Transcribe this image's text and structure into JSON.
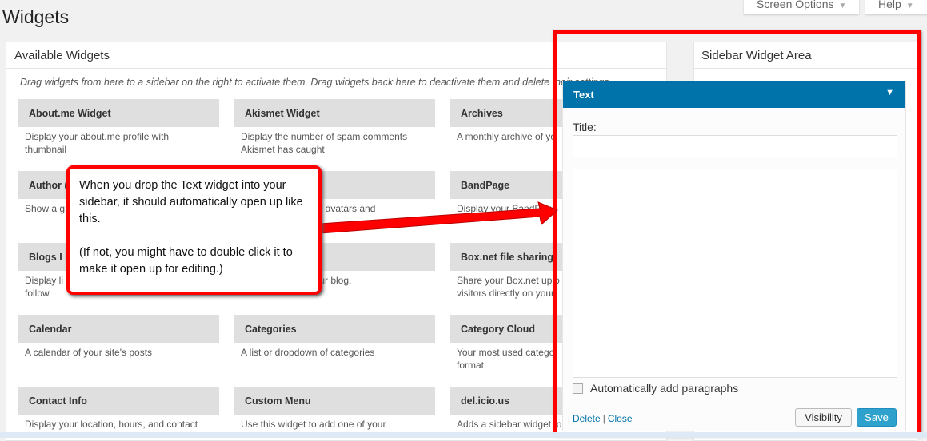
{
  "page": {
    "title": "Widgets",
    "screen_options": "Screen Options",
    "help": "Help"
  },
  "available": {
    "heading": "Available Widgets",
    "hint": "Drag widgets from here to a sidebar on the right to activate them. Drag widgets back here to deactivate them and delete their settings.",
    "widgets": [
      {
        "title": "About.me Widget",
        "desc": [
          "Display your about.me profile with",
          "thumbnail"
        ]
      },
      {
        "title": "Akismet Widget",
        "desc": [
          "Display the number of spam comments",
          "Akismet has caught"
        ]
      },
      {
        "title": "Archives",
        "desc": [
          "A monthly archive of yo"
        ]
      },
      {
        "title": "Author (",
        "desc": [
          "Show a g"
        ]
      },
      {
        "title": "",
        "desc": [
          "ors with avatars and"
        ]
      },
      {
        "title": "BandPage",
        "desc": [
          "Display your BandPage"
        ]
      },
      {
        "title": "Blogs I F",
        "desc": [
          "Display li",
          "follow"
        ]
      },
      {
        "title": "",
        "desc": [
          "r for your blog."
        ]
      },
      {
        "title": "Box.net file sharing",
        "desc": [
          "Share your Box.net uplo",
          "visitors directly on your"
        ]
      },
      {
        "title": "Calendar",
        "desc": [
          "A calendar of your site's posts"
        ]
      },
      {
        "title": "Categories",
        "desc": [
          "A list or dropdown of categories"
        ]
      },
      {
        "title": "Category Cloud",
        "desc": [
          "Your most used categor",
          "format."
        ]
      },
      {
        "title": "Contact Info",
        "desc": [
          "Display your location, hours, and contact"
        ]
      },
      {
        "title": "Custom Menu",
        "desc": [
          "Use this widget to add one of your"
        ]
      },
      {
        "title": "del.icio.us",
        "desc": [
          "Adds a sidebar widget to"
        ]
      }
    ]
  },
  "sidebar": {
    "heading": "Sidebar Widget Area"
  },
  "text_widget": {
    "header": "Text",
    "title_label": "Title:",
    "title_value": "",
    "content_value": "",
    "auto_paragraphs_label": "Automatically add paragraphs",
    "auto_paragraphs_checked": false,
    "delete": "Delete",
    "separator": "|",
    "close": "Close",
    "visibility": "Visibility",
    "save": "Save"
  },
  "callout": {
    "line1": "When you drop the Text widget into your sidebar, it should automatically open up like this.",
    "line2": "(If not, you might have to double click it to make it open up for editing.)"
  },
  "colors": {
    "accent": "#0073aa",
    "annotation": "#ff0000",
    "save_button": "#2ea2cc"
  }
}
